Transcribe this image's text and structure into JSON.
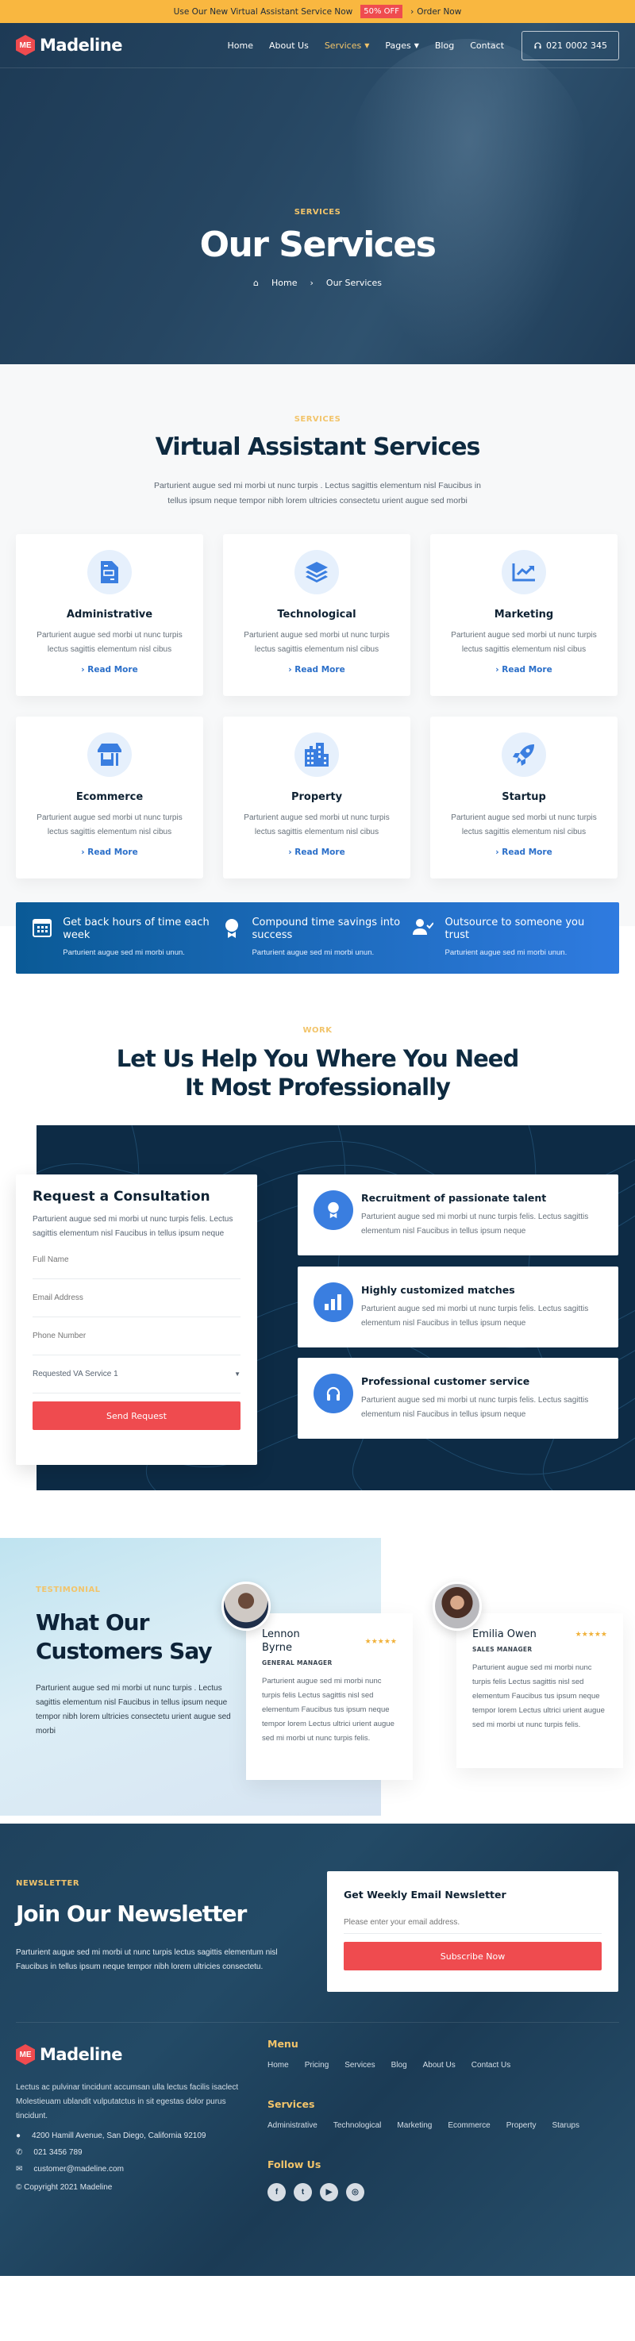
{
  "topbar": {
    "text": "Use Our New Virtual Assistant Service Now",
    "badge": "50% OFF",
    "order": "Order Now"
  },
  "nav": {
    "brand": "Madeline",
    "logo_mark": "ME",
    "items": [
      {
        "label": "Home",
        "active": false,
        "dropdown": false
      },
      {
        "label": "About Us",
        "active": false,
        "dropdown": false
      },
      {
        "label": "Services",
        "active": true,
        "dropdown": true
      },
      {
        "label": "Pages",
        "active": false,
        "dropdown": true
      },
      {
        "label": "Blog",
        "active": false,
        "dropdown": false
      },
      {
        "label": "Contact",
        "active": false,
        "dropdown": false
      }
    ],
    "phone": "021 0002 345"
  },
  "hero": {
    "eyebrow": "SERVICES",
    "title": "Our Services",
    "breadcrumb": [
      "Home",
      "Our Services"
    ]
  },
  "services": {
    "eyebrow": "SERVICES",
    "title": "Virtual Assistant Services",
    "desc": "Parturient augue sed mi morbi ut nunc turpis . Lectus sagittis elementum nisl Faucibus in tellus ipsum neque tempor nibh lorem ultricies consectetu urient augue sed morbi",
    "cards": [
      {
        "title": "Administrative",
        "icon": "document-icon",
        "text": "Parturient augue sed morbi ut nunc turpis lectus sagittis elementum nisl cibus",
        "link": "Read More"
      },
      {
        "title": "Technological",
        "icon": "layers-icon",
        "text": "Parturient augue sed morbi ut nunc turpis lectus sagittis elementum nisl cibus",
        "link": "Read More"
      },
      {
        "title": "Marketing",
        "icon": "chart-line-icon",
        "text": "Parturient augue sed morbi ut nunc turpis lectus sagittis elementum nisl cibus",
        "link": "Read More"
      },
      {
        "title": "Ecommerce",
        "icon": "store-icon",
        "text": "Parturient augue sed morbi ut nunc turpis lectus sagittis elementum nisl cibus",
        "link": "Read More"
      },
      {
        "title": "Property",
        "icon": "building-icon",
        "text": "Parturient augue sed morbi ut nunc turpis lectus sagittis elementum nisl cibus",
        "link": "Read More"
      },
      {
        "title": "Startup",
        "icon": "rocket-icon",
        "text": "Parturient augue sed morbi ut nunc turpis lectus sagittis elementum nisl cibus",
        "link": "Read More"
      }
    ]
  },
  "benefits": [
    {
      "title": "Get back hours of time each week",
      "text": "Parturient augue sed mi morbi unun.",
      "icon": "calendar-icon"
    },
    {
      "title": "Compound time savings into success",
      "text": "Parturient augue sed mi morbi unun.",
      "icon": "award-icon"
    },
    {
      "title": "Outsource to someone you trust",
      "text": "Parturient augue sed mi morbi unun.",
      "icon": "user-check-icon"
    }
  ],
  "work": {
    "eyebrow": "WORK",
    "title_line1": "Let Us Help You Where You Need",
    "title_line2": "It Most Professionally",
    "form": {
      "title": "Request a Consultation",
      "desc": "Parturient augue sed mi morbi ut nunc turpis felis. Lectus sagittis elementum nisl Faucibus in tellus ipsum neque",
      "name_placeholder": "Full Name",
      "email_placeholder": "Email Address",
      "phone_placeholder": "Phone Number",
      "service_selected": "Requested VA Service 1",
      "submit": "Send Request"
    },
    "features": [
      {
        "title": "Recruitment of passionate talent",
        "text": "Parturient augue sed mi morbi ut nunc turpis felis. Lectus sagittis elementum nisl Faucibus in tellus ipsum neque",
        "icon": "award-icon"
      },
      {
        "title": "Highly customized matches",
        "text": "Parturient augue sed mi morbi ut nunc turpis felis. Lectus sagittis elementum nisl Faucibus in tellus ipsum neque",
        "icon": "bar-chart-icon"
      },
      {
        "title": "Professional customer service",
        "text": "Parturient augue sed mi morbi ut nunc turpis felis. Lectus sagittis elementum nisl Faucibus in tellus ipsum neque",
        "icon": "headphones-icon"
      }
    ]
  },
  "testimonial": {
    "eyebrow": "TESTIMONIAL",
    "title_line1": "What Our",
    "title_line2": "Customers Say",
    "desc": "Parturient augue sed mi morbi ut nunc turpis . Lectus sagittis elementum nisl Faucibus in tellus ipsum neque tempor nibh lorem ultricies consectetu urient augue sed morbi",
    "reviews": [
      {
        "name_line1": "Lennon",
        "name_line2": "Byrne",
        "role": "GENERAL MANAGER",
        "rating": 5,
        "text": "Parturient augue sed mi morbi nunc turpis felis Lectus sagittis nisl sed elementum Faucibus tus ipsum neque tempor lorem Lectus ultrici urient augue sed mi morbi ut nunc turpis felis."
      },
      {
        "name_line1": "Emilia Owen",
        "name_line2": "",
        "role": "SALES MANAGER",
        "rating": 5,
        "text": "Parturient augue sed mi morbi nunc turpis felis Lectus sagittis nisl sed elementum Faucibus tus ipsum neque tempor lorem Lectus ultrici urient augue sed mi morbi ut nunc turpis felis."
      }
    ]
  },
  "newsletter": {
    "eyebrow": "NEWSLETTER",
    "title": "Join Our Newsletter",
    "desc": "Parturient augue sed mi morbi ut nunc turpis lectus sagittis elementum nisl Faucibus in tellus ipsum neque tempor nibh lorem ultricies consectetu.",
    "card_title": "Get Weekly Email Newsletter",
    "placeholder": "Please enter your email address.",
    "button": "Subscribe Now"
  },
  "footer": {
    "brand": "Madeline",
    "about": "Lectus ac pulvinar tincidunt accumsan ulla lectus facilis isaclect Molestieuam ublandit vulputatctus in sit egestas dolor purus tincidunt.",
    "address": "4200 Hamill Avenue, San Diego, California 92109",
    "phone": "021 3456 789",
    "email": "customer@madeline.com",
    "copyright": "© Copyright 2021 Madeline",
    "menu_title": "Menu",
    "menu": [
      "Home",
      "Pricing",
      "Services",
      "Blog",
      "About Us",
      "Contact Us"
    ],
    "services_title": "Services",
    "services": [
      "Administrative",
      "Technological",
      "Marketing",
      "Ecommerce",
      "Property",
      "Starups"
    ],
    "follow_title": "Follow Us",
    "social": [
      {
        "name": "facebook",
        "glyph": "f"
      },
      {
        "name": "twitter",
        "glyph": "t"
      },
      {
        "name": "youtube",
        "glyph": "▶"
      },
      {
        "name": "instagram",
        "glyph": "◎"
      }
    ]
  },
  "colors": {
    "accent": "#f9b740",
    "brand_red": "#ef4b4f",
    "primary_blue": "#3a7ee0",
    "navy": "#0d2b45",
    "gold": "#f2c46a"
  }
}
